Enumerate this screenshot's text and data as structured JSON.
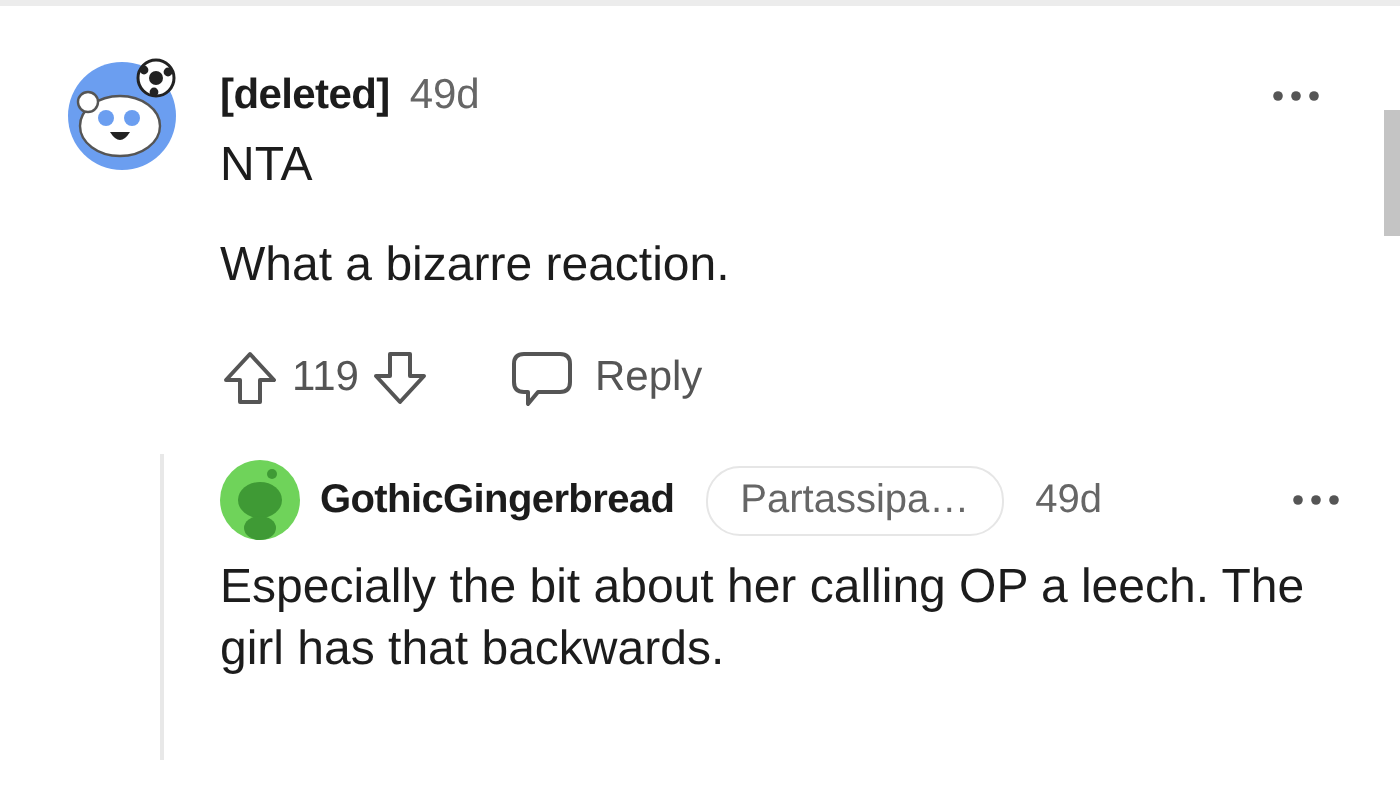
{
  "comment": {
    "author": "[deleted]",
    "age": "49d",
    "paragraphs": [
      "NTA",
      "What a bizarre reaction."
    ],
    "score": "119",
    "reply_label": "Reply"
  },
  "reply": {
    "author": "GothicGingerbread",
    "flair": "Partassipa…",
    "age": "49d",
    "body": "Especially the bit about her calling OP a leech. The girl has that backwards."
  }
}
